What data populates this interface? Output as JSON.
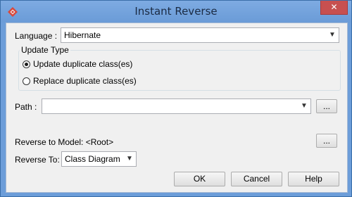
{
  "window": {
    "title": "Instant Reverse",
    "close_glyph": "✕",
    "icon": "app-logo-icon"
  },
  "language": {
    "label": "Language :",
    "value": "Hibernate"
  },
  "update_type": {
    "title": "Update Type",
    "options": [
      {
        "label": "Update duplicate class(es)",
        "selected": true
      },
      {
        "label": "Replace duplicate class(es)",
        "selected": false
      }
    ]
  },
  "path": {
    "label": "Path :",
    "value": "",
    "browse_label": "..."
  },
  "reverse_model": {
    "label": "Reverse to Model: <Root>",
    "browse_label": "..."
  },
  "reverse_to": {
    "label": "Reverse To:",
    "value": "Class Diagram"
  },
  "buttons": {
    "ok": "OK",
    "cancel": "Cancel",
    "help": "Help"
  },
  "colors": {
    "frame": "#6c9dd9",
    "client_bg": "#f0f0f0",
    "close_button": "#c75050"
  }
}
